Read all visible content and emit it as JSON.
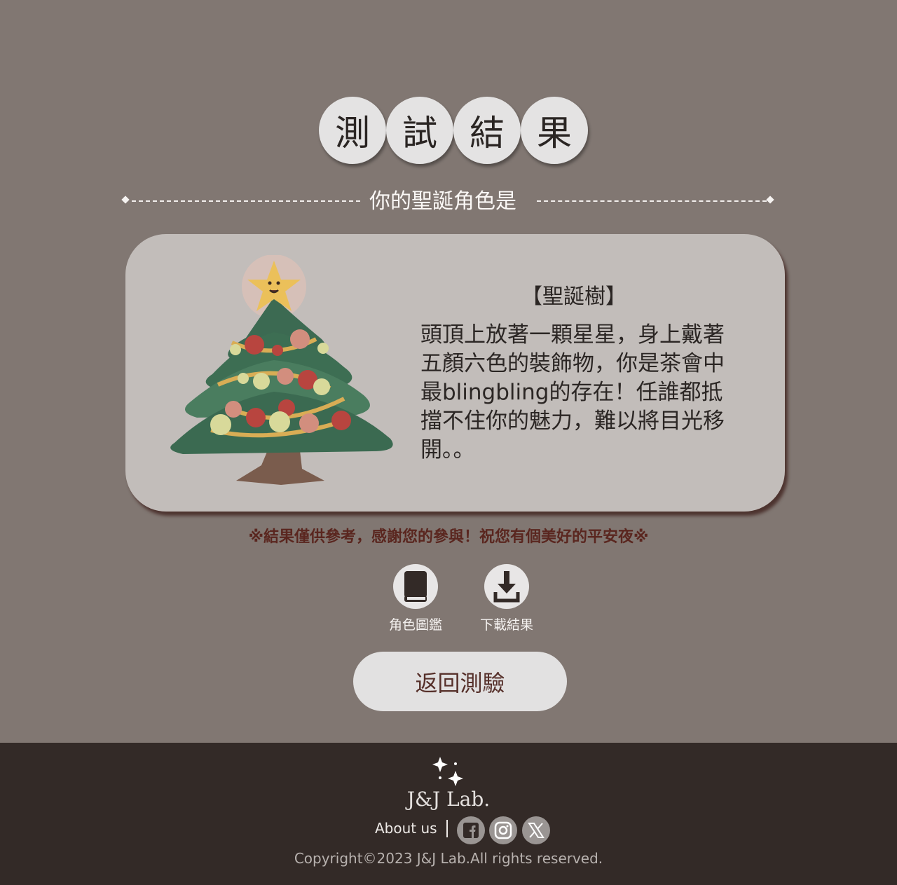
{
  "title": {
    "chars": [
      "測",
      "試",
      "結",
      "果"
    ]
  },
  "subtitle": "你的聖誕角色是",
  "result": {
    "name": "【聖誕樹】",
    "description": "頭頂上放著一顆星星，身上戴著五顏六色的裝飾物，你是茶會中最blingbling的存在！任誰都抵擋不住你的魅力，難以將目光移開。。",
    "image_icon": "christmas-tree-character"
  },
  "note": "※結果僅供參考，感謝您的參與！祝您有個美好的平安夜※",
  "actions": {
    "gallery_label": "角色圖鑑",
    "download_label": "下載結果"
  },
  "back_button": "返回測驗",
  "footer": {
    "brand": "J&J Lab.",
    "about": "About us",
    "social": [
      "facebook-icon",
      "instagram-icon",
      "x-icon"
    ],
    "copyright": "Copyright©2023 J&J Lab.All rights reserved."
  },
  "colors": {
    "background": "#817772",
    "card": "#c2bdba",
    "footer": "#332a27",
    "note": "#5a261f"
  }
}
